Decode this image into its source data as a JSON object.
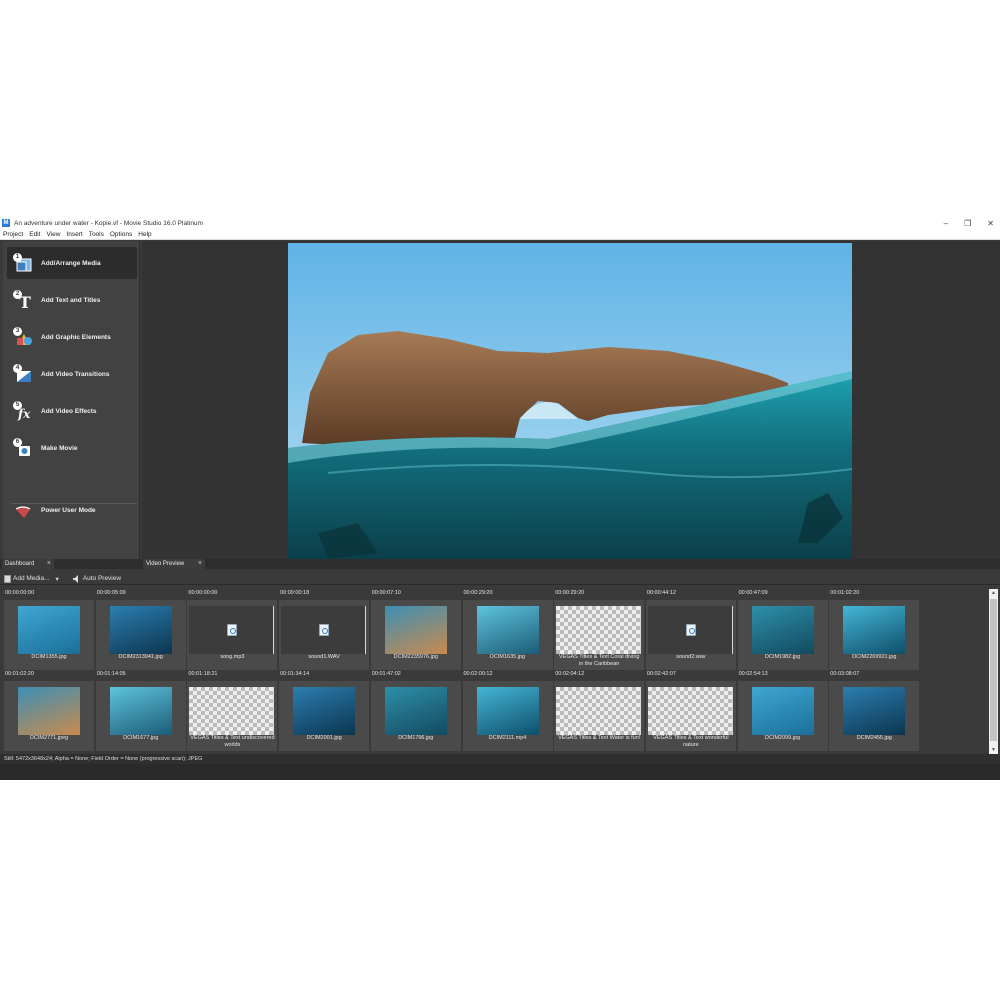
{
  "window": {
    "title": "An adventure under water - Kopie.vf - Movie Studio 16.0 Platinum",
    "app_icon": "M",
    "controls": [
      "–",
      "❐",
      "✕"
    ]
  },
  "menu": [
    "Project",
    "Edit",
    "View",
    "Insert",
    "Tools",
    "Options",
    "Help"
  ],
  "dashboard": {
    "items": [
      {
        "num": "1",
        "label": "Add/Arrange Media",
        "icon": "media-icon"
      },
      {
        "num": "2",
        "label": "Add Text and Titles",
        "icon": "text-icon"
      },
      {
        "num": "3",
        "label": "Add Graphic Elements",
        "icon": "shapes-icon"
      },
      {
        "num": "4",
        "label": "Add Video Transitions",
        "icon": "transition-icon"
      },
      {
        "num": "5",
        "label": "Add Video Effects",
        "icon": "fx-icon"
      },
      {
        "num": "6",
        "label": "Make Movie",
        "icon": "movie-icon"
      }
    ],
    "power_user": "Power User Mode"
  },
  "tabs": {
    "dashboard": "Dashboard",
    "video_preview": "Video Preview",
    "close": "×"
  },
  "media_toolbar": {
    "add_media": "Add Media...",
    "auto_preview": "Auto Preview"
  },
  "media": [
    {
      "time": "00:00:00:00",
      "name": "DCIM1355.jpg",
      "kind": "photo"
    },
    {
      "time": "00:00:05:09",
      "name": "DCIM2313941.jpg",
      "kind": "photo"
    },
    {
      "time": "00:00:00:00",
      "name": "song.mp3",
      "kind": "audio"
    },
    {
      "time": "00:00:00:18",
      "name": "sound1.WAV",
      "kind": "audio"
    },
    {
      "time": "00:00:07:10",
      "name": "DCIM2235976.jpg",
      "kind": "photo"
    },
    {
      "time": "00:00:29:20",
      "name": "DCIM1635.jpg",
      "kind": "photo"
    },
    {
      "time": "00:00:29:20",
      "name": "VEGAS Titles & Text Coral diving in the Caribbean",
      "kind": "title"
    },
    {
      "time": "00:00:44:12",
      "name": "sound2.wav",
      "kind": "audio"
    },
    {
      "time": "00:00:47:09",
      "name": "DCIM1982.jpg",
      "kind": "photo"
    },
    {
      "time": "00:01:02:20",
      "name": "DCIM2269921.jpg",
      "kind": "photo"
    },
    {
      "time": "00:01:02:20",
      "name": "DCIM2771.jpeg",
      "kind": "photo"
    },
    {
      "time": "00:01:14:05",
      "name": "DCIM1677.jpg",
      "kind": "photo"
    },
    {
      "time": "00:01:18:21",
      "name": "VEGAS Titles & Text undiscovered worlds",
      "kind": "title"
    },
    {
      "time": "00:01:34:14",
      "name": "DCIM2001.jpg",
      "kind": "photo"
    },
    {
      "time": "00:01:47:02",
      "name": "DCIM1796.jpg",
      "kind": "photo"
    },
    {
      "time": "00:02:00:12",
      "name": "DCIM2111.mp4",
      "kind": "photo"
    },
    {
      "time": "00:02:04:12",
      "name": "VEGAS Titles & Text Water is fun!",
      "kind": "title"
    },
    {
      "time": "00:02:42:07",
      "name": "VEGAS Titles & Text wonderful nature",
      "kind": "title"
    },
    {
      "time": "00:02:54:13",
      "name": "DCIM2099.jpg",
      "kind": "photo"
    },
    {
      "time": "00:03:08:07",
      "name": "DCIM2455.jpg",
      "kind": "photo"
    }
  ],
  "status": "Still: 5472x3648x24; Alpha = None; Field Order = None (progressive scan); JPEG",
  "colors": {
    "panel": "#424242",
    "background": "#3a3a3a",
    "accent": "#2a7fd4",
    "water": "#1e7f8e"
  }
}
